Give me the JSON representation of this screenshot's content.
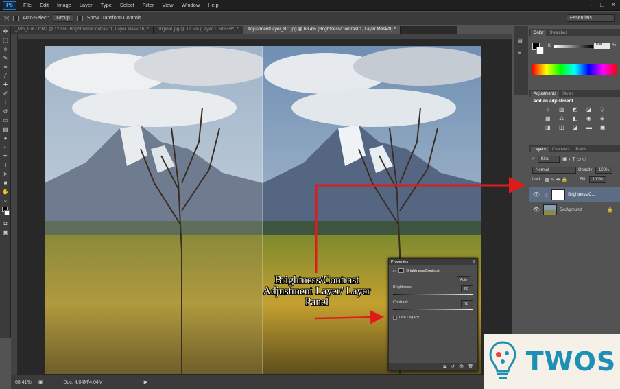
{
  "menu": {
    "app_logo": "Ps",
    "items": [
      "File",
      "Edit",
      "Image",
      "Layer",
      "Type",
      "Select",
      "Filter",
      "View",
      "Window",
      "Help"
    ],
    "window_controls": [
      "–",
      "□",
      "✕"
    ]
  },
  "options_bar": {
    "auto_select_label": "Auto-Select:",
    "auto_select_value": "Group",
    "transform_label": "Show Transform Controls",
    "workspace": "Essentials"
  },
  "doc_tabs": [
    {
      "label": "_MG_8767.CR2 @ 12.5% (Brightness/Contrast 1, Layer Mask/16) *"
    },
    {
      "label": "original.jpg @ 12.5% (Layer 1, RGB/8*) *"
    },
    {
      "label": "AdjustmentLayer_BC.jpg @ 68.4% (Brightness/Contrast 1, Layer Mask/8) *"
    }
  ],
  "status_bar": {
    "zoom": "68.41%",
    "doc_size": "Doc: 4.04M/4.04M"
  },
  "color_panel": {
    "tabs": [
      "Color",
      "Swatches"
    ],
    "channel": "K",
    "value": "100",
    "unit": "%"
  },
  "adjustments_panel": {
    "tabs": [
      "Adjustments",
      "Styles"
    ],
    "heading": "Add an adjustment"
  },
  "layers_panel": {
    "tabs": [
      "Layers",
      "Channels",
      "Paths"
    ],
    "filter_kind": "Kind",
    "blend_mode": "Normal",
    "opacity_label": "Opacity:",
    "opacity_value": "100%",
    "lock_label": "Lock:",
    "fill_label": "Fill:",
    "fill_value": "100%",
    "layers": [
      {
        "name": "Brightness/C...",
        "selected": true
      },
      {
        "name": "Background",
        "selected": false
      }
    ]
  },
  "properties_panel": {
    "title": "Properties",
    "heading": "Brightness/Contrast",
    "auto_label": "Auto",
    "brightness_label": "Brightness:",
    "brightness_value": "68",
    "contrast_label": "Contrast:",
    "contrast_value": "78",
    "legacy_label": "Use Legacy"
  },
  "annotation": {
    "text": "Brightness/Contrast Adjustment Layer/ Layer Panel",
    "arrow_color": "#e01b1b"
  },
  "logo": {
    "wordmark": "TWOS",
    "color": "#1e90b5"
  }
}
